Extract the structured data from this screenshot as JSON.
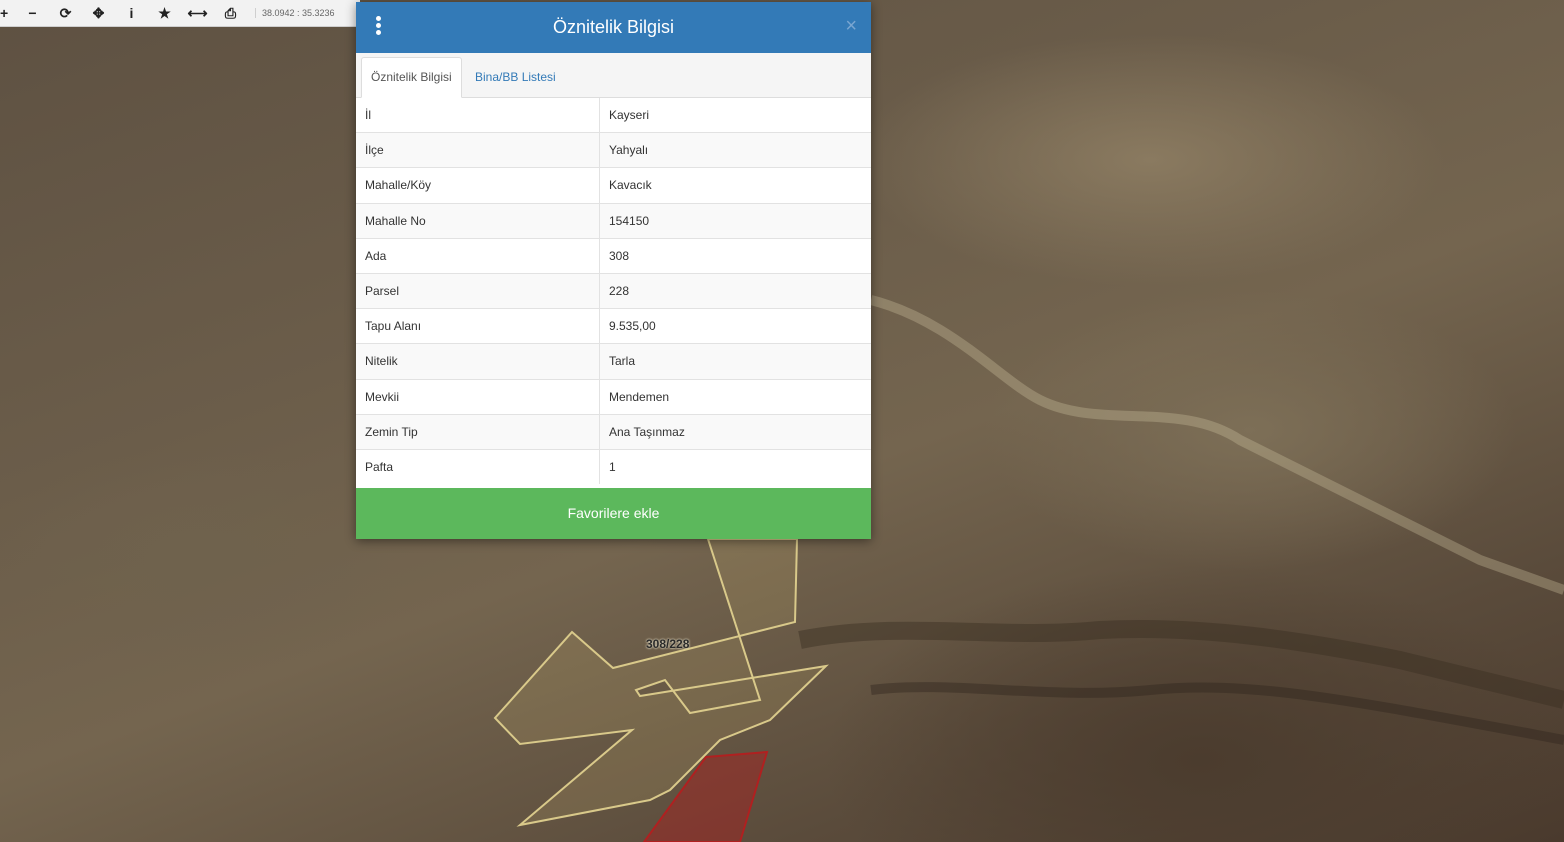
{
  "toolbar": {
    "coordinates": "38.0942 : 35.3236",
    "tools": [
      {
        "icon": "zoom-in-icon",
        "glyph": "+"
      },
      {
        "icon": "zoom-out-icon",
        "glyph": "−"
      },
      {
        "icon": "refresh-icon",
        "glyph": "⟳"
      },
      {
        "icon": "pan-icon",
        "glyph": "✥"
      },
      {
        "icon": "info-icon",
        "glyph": "i"
      },
      {
        "icon": "favorite-star-icon",
        "glyph": "★"
      },
      {
        "icon": "measure-icon",
        "glyph": "⟷"
      },
      {
        "icon": "print-icon",
        "glyph": "⎙"
      }
    ]
  },
  "dialog": {
    "title": "Öznitelik Bilgisi",
    "close_glyph": "×",
    "tabs": [
      {
        "label": "Öznitelik Bilgisi",
        "active": true
      },
      {
        "label": "Bina/BB Listesi",
        "active": false
      }
    ],
    "rows": [
      {
        "key": "İl",
        "value": "Kayseri"
      },
      {
        "key": "İlçe",
        "value": "Yahyalı"
      },
      {
        "key": "Mahalle/Köy",
        "value": "Kavacık"
      },
      {
        "key": "Mahalle No",
        "value": "154150"
      },
      {
        "key": "Ada",
        "value": "308"
      },
      {
        "key": "Parsel",
        "value": "228"
      },
      {
        "key": "Tapu Alanı",
        "value": "9.535,00"
      },
      {
        "key": "Nitelik",
        "value": "Tarla"
      },
      {
        "key": "Mevkii",
        "value": "Mendemen"
      },
      {
        "key": "Zemin Tip",
        "value": "Ana Taşınmaz"
      },
      {
        "key": "Pafta",
        "value": "1"
      }
    ],
    "button_label": "Favorilere ekle"
  },
  "map": {
    "parcel_label": "308/228",
    "colors": {
      "header": "#337ab7",
      "button": "#5cb85c",
      "parcel_outline": "#d9c98a",
      "neighbor_parcel": "#b02020"
    }
  }
}
